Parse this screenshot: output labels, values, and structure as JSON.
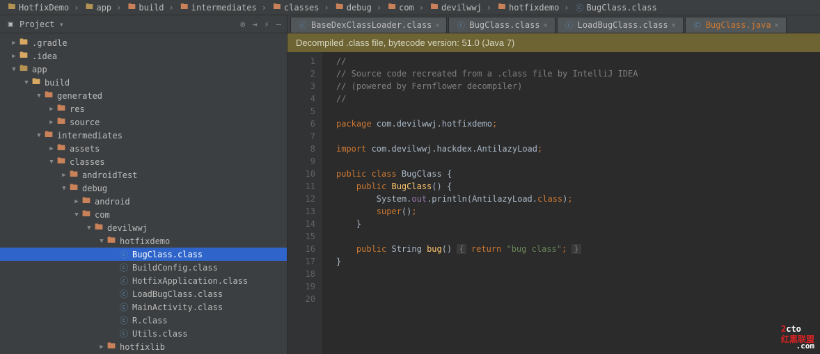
{
  "breadcrumb": [
    "HotfixDemo",
    "app",
    "build",
    "intermediates",
    "classes",
    "debug",
    "com",
    "devilwwj",
    "hotfixdemo",
    "BugClass.class"
  ],
  "sidebar": {
    "title": "Project"
  },
  "tree": [
    {
      "d": 0,
      "a": "▶",
      "ic": "folder-s",
      "t": ".gradle"
    },
    {
      "d": 0,
      "a": "▶",
      "ic": "folder-s",
      "t": ".idea"
    },
    {
      "d": 0,
      "a": "▼",
      "ic": "folder",
      "t": "app"
    },
    {
      "d": 1,
      "a": "▼",
      "ic": "folder-s",
      "t": "build"
    },
    {
      "d": 2,
      "a": "▼",
      "ic": "folder-b",
      "t": "generated"
    },
    {
      "d": 3,
      "a": "▶",
      "ic": "folder-b",
      "t": "res"
    },
    {
      "d": 3,
      "a": "▶",
      "ic": "folder-b",
      "t": "source"
    },
    {
      "d": 2,
      "a": "▼",
      "ic": "folder-b",
      "t": "intermediates"
    },
    {
      "d": 3,
      "a": "▶",
      "ic": "folder-b",
      "t": "assets"
    },
    {
      "d": 3,
      "a": "▼",
      "ic": "folder-b",
      "t": "classes"
    },
    {
      "d": 4,
      "a": "▶",
      "ic": "folder-b",
      "t": "androidTest"
    },
    {
      "d": 4,
      "a": "▼",
      "ic": "folder-b",
      "t": "debug"
    },
    {
      "d": 5,
      "a": "▶",
      "ic": "folder-b",
      "t": "android"
    },
    {
      "d": 5,
      "a": "▼",
      "ic": "folder-b",
      "t": "com"
    },
    {
      "d": 6,
      "a": "▼",
      "ic": "folder-b",
      "t": "devilwwj"
    },
    {
      "d": 7,
      "a": "▼",
      "ic": "folder-b",
      "t": "hotfixdemo"
    },
    {
      "d": 8,
      "a": "",
      "ic": "class",
      "t": "BugClass.class",
      "sel": true
    },
    {
      "d": 8,
      "a": "",
      "ic": "class",
      "t": "BuildConfig.class"
    },
    {
      "d": 8,
      "a": "",
      "ic": "class",
      "t": "HotfixApplication.class"
    },
    {
      "d": 8,
      "a": "",
      "ic": "class",
      "t": "LoadBugClass.class"
    },
    {
      "d": 8,
      "a": "",
      "ic": "class",
      "t": "MainActivity.class"
    },
    {
      "d": 8,
      "a": "",
      "ic": "class",
      "t": "R.class"
    },
    {
      "d": 8,
      "a": "",
      "ic": "class",
      "t": "Utils.class"
    },
    {
      "d": 7,
      "a": "▶",
      "ic": "folder-b",
      "t": "hotfixlib"
    }
  ],
  "tabs": [
    {
      "label": "BaseDexClassLoader.class",
      "java": false
    },
    {
      "label": "BugClass.class",
      "java": false,
      "active": true
    },
    {
      "label": "LoadBugClass.class",
      "java": false
    },
    {
      "label": "BugClass.java",
      "java": true
    }
  ],
  "banner": "Decompiled .class file, bytecode version: 51.0 (Java 7)",
  "code": {
    "package": "com.devilwwj.hotfixdemo",
    "import": "com.devilwwj.hackdex.AntilazyLoad",
    "className": "BugClass",
    "ctor_line": "System.out.println(AntilazyLoad.class);",
    "method": "bug",
    "returnType": "String",
    "retval": "\"bug class\"",
    "comments": [
      "//",
      "// Source code recreated from a .class file by IntelliJ IDEA",
      "// (powered by Fernflower decompiler)",
      "//"
    ]
  },
  "watermark": {
    "a": "2",
    "b": "cto",
    "c": ".com",
    "tag": "红黑联盟"
  }
}
